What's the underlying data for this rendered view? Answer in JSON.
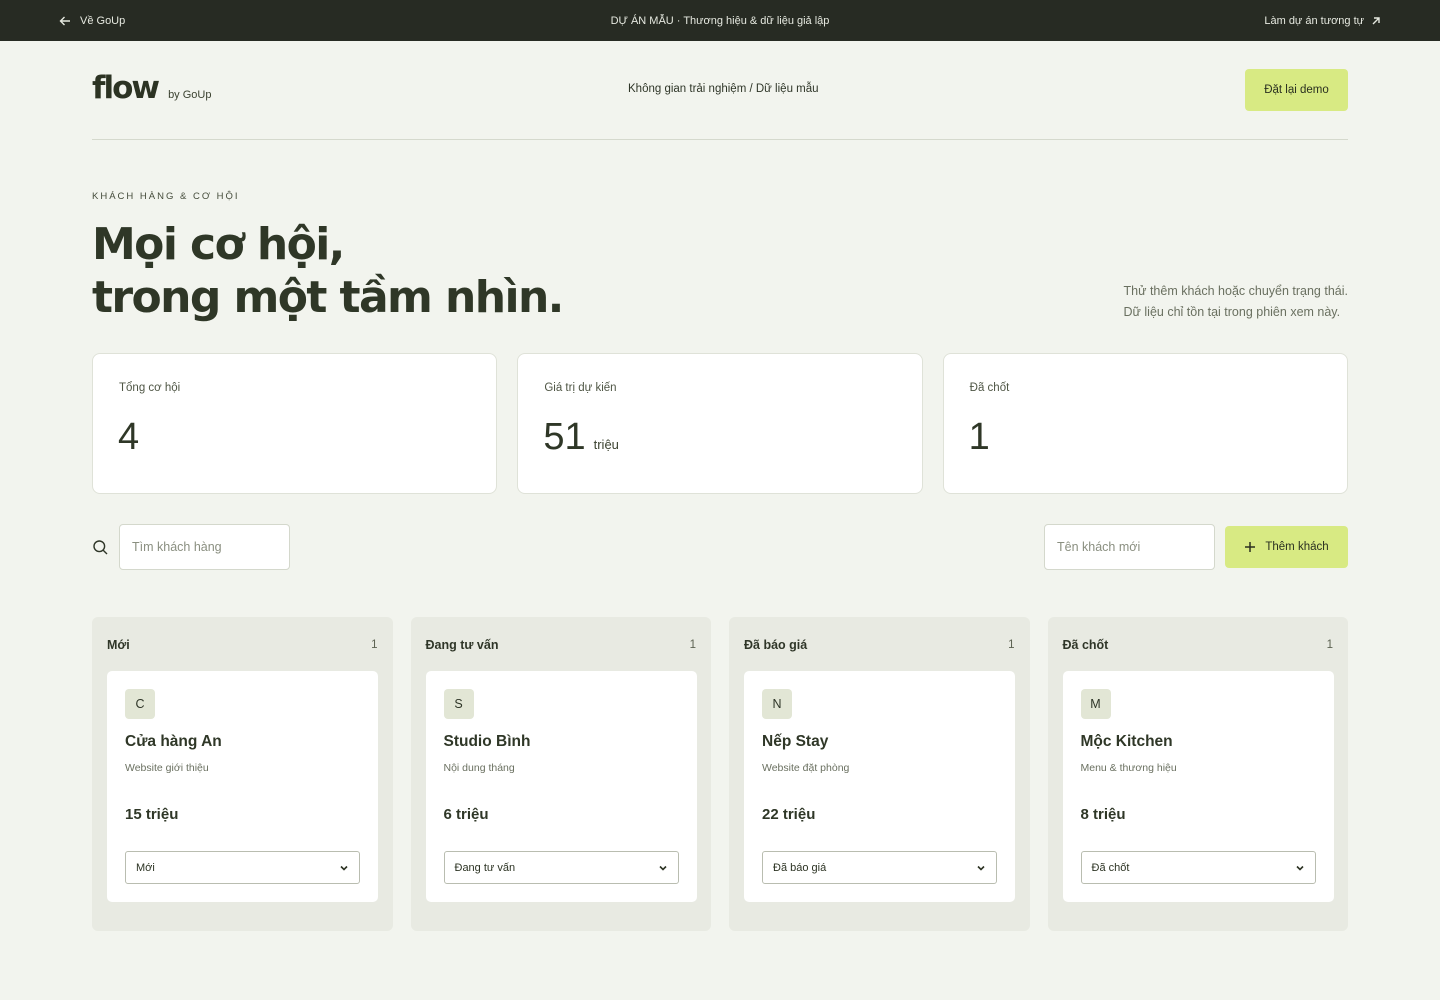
{
  "topbar": {
    "back_label": "Về GoUp",
    "center_text": "DỰ ÁN MẪU · Thương hiệu & dữ liệu giả lập",
    "cta_label": "Làm dự án tương tự"
  },
  "header": {
    "logo": "flow",
    "logo_by": "by GoUp",
    "breadcrumb": "Không gian trải nghiệm / Dữ liệu mẫu",
    "reset_label": "Đặt lại demo"
  },
  "hero": {
    "eyebrow": "KHÁCH HÀNG & CƠ HỘI",
    "title_line1": "Mọi cơ hội,",
    "title_line2": "trong một tầm nhìn.",
    "note_line1": "Thử thêm khách hoặc chuyển trạng thái.",
    "note_line2": "Dữ liệu chỉ tồn tại trong phiên xem này."
  },
  "stats": [
    {
      "label": "Tổng cơ hội",
      "value": "4",
      "unit": ""
    },
    {
      "label": "Giá trị dự kiến",
      "value": "51",
      "unit": "triệu"
    },
    {
      "label": "Đã chốt",
      "value": "1",
      "unit": ""
    }
  ],
  "toolbar": {
    "search_placeholder": "Tìm khách hàng",
    "new_placeholder": "Tên khách mới",
    "add_label": "Thêm khách"
  },
  "board": {
    "columns": [
      {
        "title": "Mới",
        "count": "1",
        "card": {
          "initial": "C",
          "name": "Cửa hàng An",
          "desc": "Website giới thiệu",
          "value": "15 triệu",
          "status": "Mới"
        }
      },
      {
        "title": "Đang tư vấn",
        "count": "1",
        "card": {
          "initial": "S",
          "name": "Studio Bình",
          "desc": "Nội dung tháng",
          "value": "6 triệu",
          "status": "Đang tư vấn"
        }
      },
      {
        "title": "Đã báo giá",
        "count": "1",
        "card": {
          "initial": "N",
          "name": "Nếp Stay",
          "desc": "Website đặt phòng",
          "value": "22 triệu",
          "status": "Đã báo giá"
        }
      },
      {
        "title": "Đã chốt",
        "count": "1",
        "card": {
          "initial": "M",
          "name": "Mộc Kitchen",
          "desc": "Menu & thương hiệu",
          "value": "8 triệu",
          "status": "Đã chốt"
        }
      }
    ]
  },
  "colors": {
    "topbar_bg": "#272b23",
    "accent": "#d8ea83",
    "page_bg": "#f2f4ee",
    "column_bg": "#e8eae2"
  }
}
